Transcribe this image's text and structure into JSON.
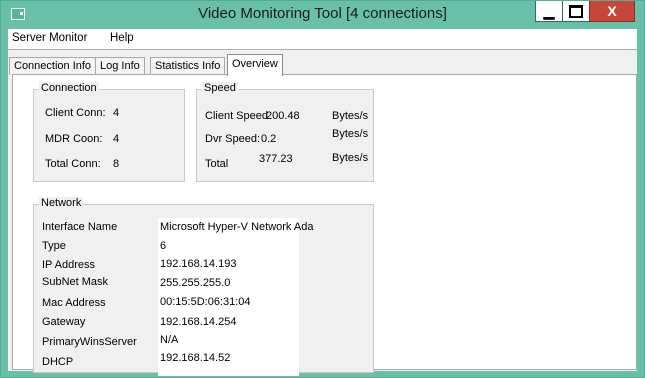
{
  "window": {
    "title": "Video Monitoring Tool [4 connections]"
  },
  "titlebar_buttons": {
    "minimize": "▁",
    "close": "X"
  },
  "menu": [
    "Server Monitor",
    "Help"
  ],
  "tabs": [
    {
      "label": "Connection Info"
    },
    {
      "label": "Log Info"
    },
    {
      "label": "Statistics Info"
    },
    {
      "label": "Overview",
      "active": true
    }
  ],
  "connection": {
    "title": "Connection",
    "rows": [
      {
        "label": "Client Conn:",
        "value": "4"
      },
      {
        "label": "MDR Coon:",
        "value": "4"
      },
      {
        "label": "Total Conn:",
        "value": "8"
      }
    ]
  },
  "speed": {
    "title": "Speed",
    "rows": [
      {
        "label": "Client Speed",
        "value": "200.48",
        "unit": "Bytes/s"
      },
      {
        "label": "Dvr Speed:",
        "value": "0.2",
        "unit": "Bytes/s"
      },
      {
        "label": "Total",
        "value": "377.23",
        "unit": "Bytes/s"
      }
    ]
  },
  "network": {
    "title": "Network",
    "rows": [
      {
        "label": "Interface Name",
        "value": "Microsoft Hyper-V Network Ada"
      },
      {
        "label": "Type",
        "value": "6"
      },
      {
        "label": "IP Address",
        "value": "192.168.14.193"
      },
      {
        "label": "SubNet Mask",
        "value": "255.255.255.0"
      },
      {
        "label": "Mac Address",
        "value": "00:15:5D:06:31:04"
      },
      {
        "label": "Gateway",
        "value": "192.168.14.254"
      },
      {
        "label": "PrimaryWinsServer",
        "value": "N/A"
      },
      {
        "label": "DHCP",
        "value": "192.168.14.52"
      }
    ]
  }
}
